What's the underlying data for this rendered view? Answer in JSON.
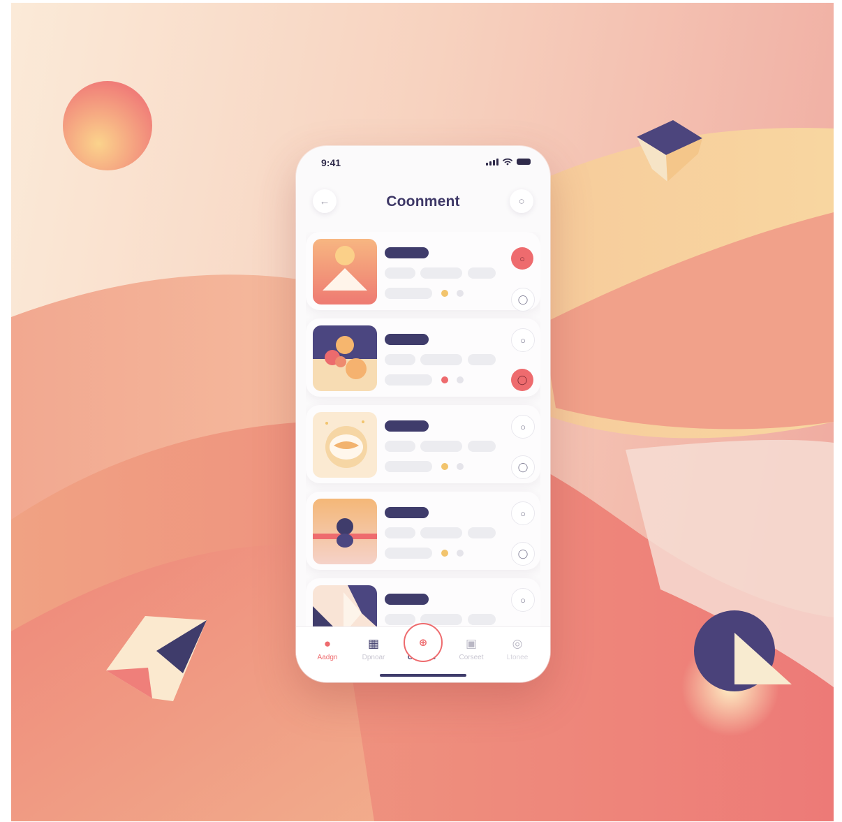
{
  "status_bar": {
    "time": "9:41"
  },
  "header": {
    "title": "Coonment",
    "back_icon": "arrow-left-icon",
    "menu_icon": "circle-icon"
  },
  "list": {
    "items": [
      {
        "thumb": "sunset-mountain",
        "dot_color": "#f2c46d",
        "top_btn_accent": true
      },
      {
        "thumb": "spheres",
        "dot_color": "#ee6b6e",
        "top_btn_accent": false
      },
      {
        "thumb": "bowl",
        "dot_color": "#f2c46d",
        "top_btn_accent": false
      },
      {
        "thumb": "figure",
        "dot_color": "#f2c46d",
        "top_btn_accent": false
      },
      {
        "thumb": "shapes",
        "dot_color": "#f2c46d",
        "top_btn_accent": false
      }
    ]
  },
  "tab_bar": {
    "tabs": [
      {
        "label": "Aadgn",
        "icon": "chat-icon"
      },
      {
        "label": "Dpnoar",
        "icon": "document-icon"
      },
      {
        "label": "Cochore",
        "icon": "center-plus-icon"
      },
      {
        "label": "Corseet",
        "icon": "folder-icon"
      },
      {
        "label": "Ltonee",
        "icon": "message-icon"
      }
    ]
  },
  "colors": {
    "accent": "#ee6b6e",
    "navy": "#3f3c6b",
    "peach": "#f7c98a",
    "background_top": "#fbead8"
  }
}
